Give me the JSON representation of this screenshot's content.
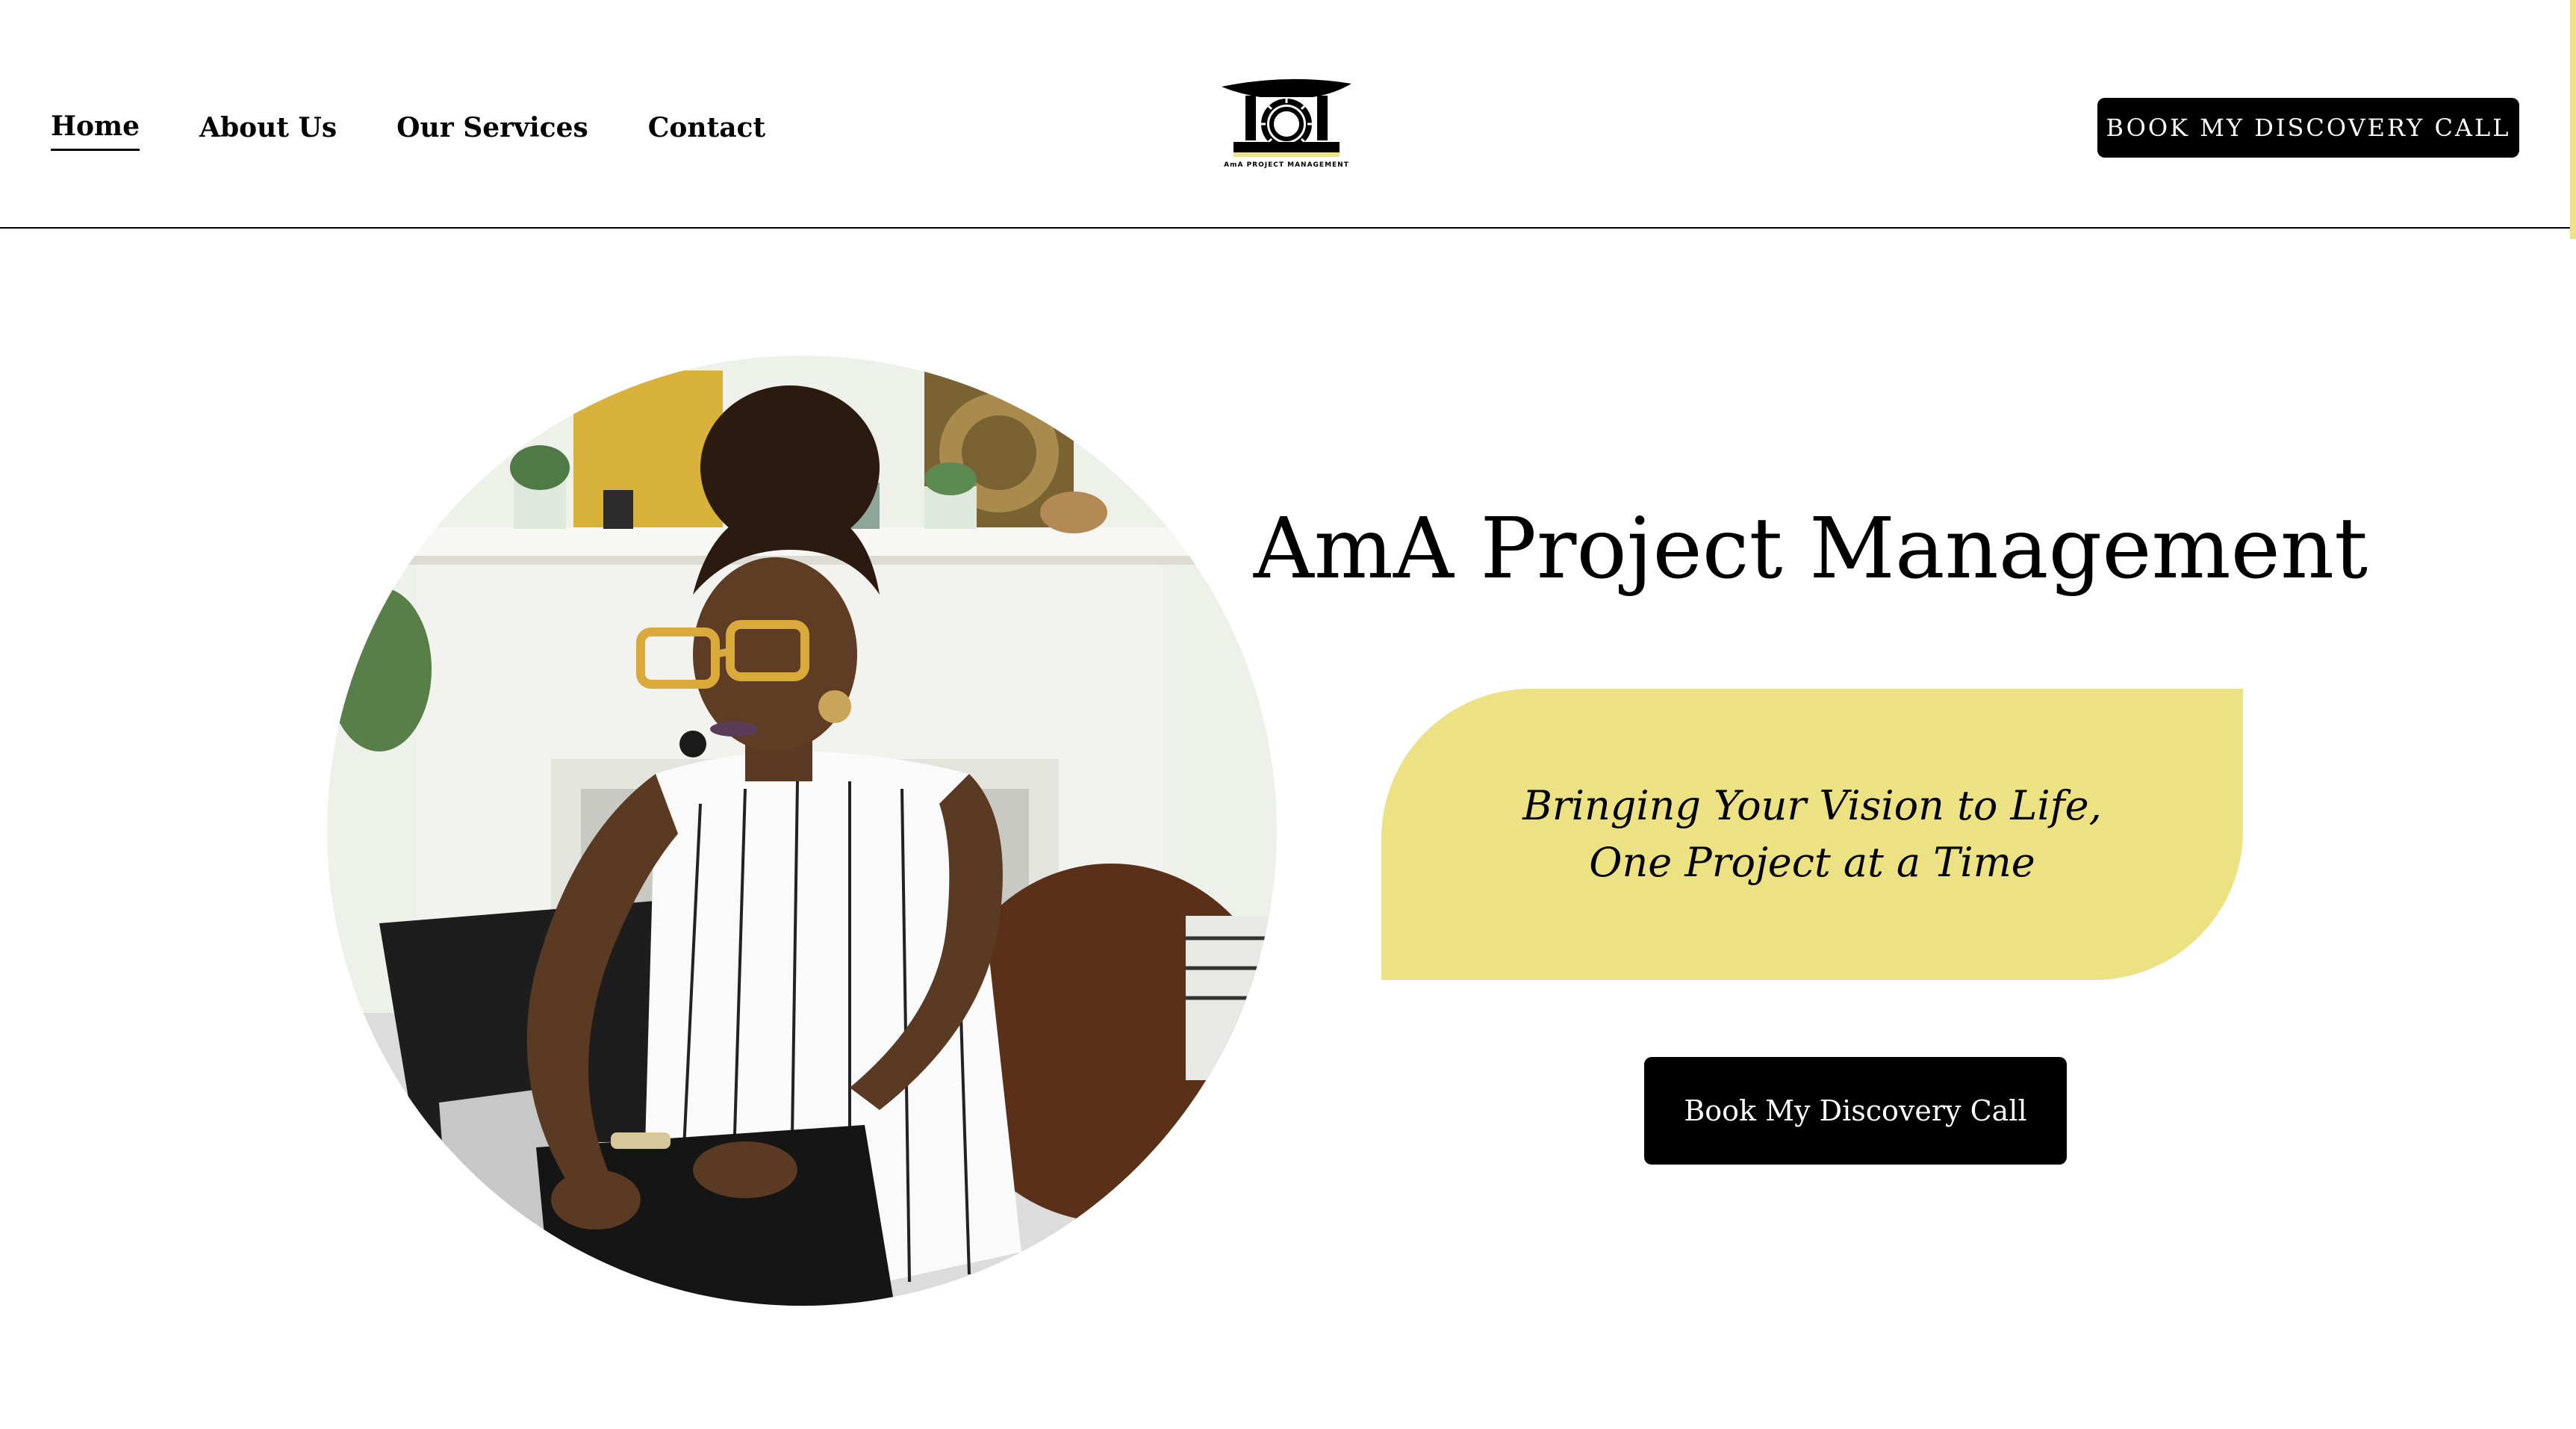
{
  "header": {
    "nav": [
      {
        "label": "Home",
        "active": true
      },
      {
        "label": "About Us"
      },
      {
        "label": "Our Services"
      },
      {
        "label": "Contact"
      }
    ],
    "logo_text": "AmA PROJECT MANAGEMENT",
    "cta_label": "BOOK MY DISCOVERY CALL"
  },
  "hero": {
    "title": "AmA Project Management",
    "tagline": "Bringing Your Vision to Life, One Project at a Time",
    "cta_label": "Book My Discovery Call"
  },
  "colors": {
    "accent_yellow": "#ece183",
    "button_bg": "#000000",
    "button_text": "#ffffff",
    "page_bg": "#ffffff"
  },
  "icons": {
    "logo": "stool-and-sun-emblem"
  }
}
